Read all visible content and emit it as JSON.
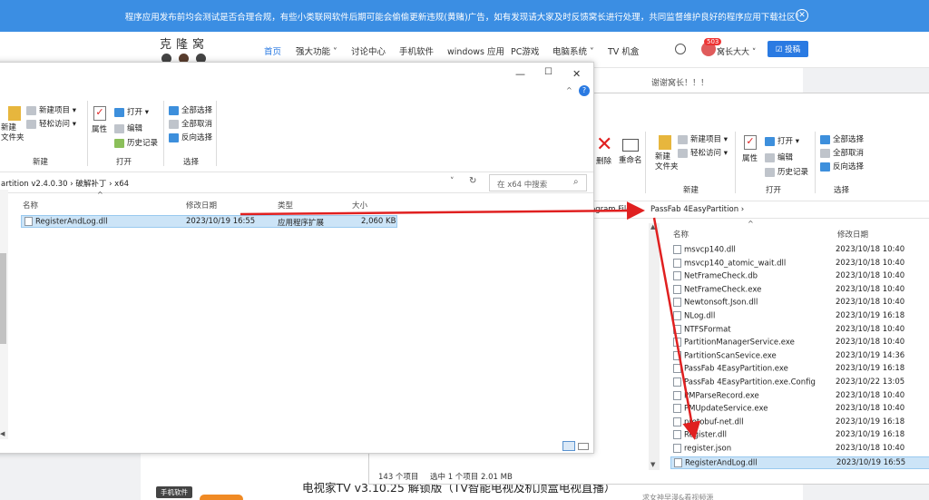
{
  "banner": {
    "text": "程序应用发布前均会测试是否合理合规，有些小类联网软件后期可能会偷偷更新违规(黄赌)广告，如有发现请大家及时反馈窝长进行处理，共同监督维护良好的程序应用下载社区！",
    "close": "✕"
  },
  "site": {
    "logo": "克隆窝",
    "nav": [
      "首页",
      "强大功能 ˅",
      "讨论中心",
      "手机软件",
      "windows 应用",
      "PC游戏",
      "电脑系统 ˅",
      "TV 机盒"
    ],
    "badge": "503",
    "user": "窝长大大 ˅",
    "post": "☑ 投稿",
    "thanks": "谢谢窝长！！！",
    "bottom_title": "电视家TV v3.10.25 解锁版（TV智能电视及机顶盒电视直播）",
    "tag_phone": "手机软件",
    "bottom_right": "求女神早漫&看视频源"
  },
  "win1": {
    "ribbon": {
      "new_folder": "新建\n文件夹",
      "new_item": "新建项目 ▾",
      "easy_access": "轻松访问 ▾",
      "new_group": "新建",
      "properties": "属性",
      "open": "打开 ▾",
      "edit": "编辑",
      "history": "历史记录",
      "open_group": "打开",
      "select_all": "全部选择",
      "select_none": "全部取消",
      "invert": "反向选择",
      "select_group": "选择"
    },
    "address": "artition v2.4.0.30  ›  破解补丁  ›  x64",
    "search_placeholder": "在 x64 中搜索",
    "columns": {
      "name": "名称",
      "date": "修改日期",
      "type": "类型",
      "size": "大小"
    },
    "files": [
      {
        "name": "RegisterAndLog.dll",
        "date": "2023/10/19 16:55",
        "type": "应用程序扩展",
        "size": "2,060 KB"
      }
    ]
  },
  "win2": {
    "ribbon": {
      "delete": "删除",
      "rename": "重命名",
      "new_folder": "新建\n文件夹",
      "new_item": "新建项目 ▾",
      "easy_access": "轻松访问 ▾",
      "new_group": "新建",
      "properties": "属性",
      "open": "打开 ▾",
      "edit": "编辑",
      "history": "历史记录",
      "open_group": "打开",
      "select_all": "全部选择",
      "select_none": "全部取消",
      "invert": "反向选择",
      "select_group": "选择"
    },
    "address_left": "ogram Files",
    "address": "PassFab 4EasyPartition  ›",
    "columns": {
      "name": "名称",
      "date": "修改日期"
    },
    "files": [
      {
        "name": "msvcp140.dll",
        "date": "2023/10/18 10:40"
      },
      {
        "name": "msvcp140_atomic_wait.dll",
        "date": "2023/10/18 10:40"
      },
      {
        "name": "NetFrameCheck.db",
        "date": "2023/10/18 10:40"
      },
      {
        "name": "NetFrameCheck.exe",
        "date": "2023/10/18 10:40"
      },
      {
        "name": "Newtonsoft.Json.dll",
        "date": "2023/10/18 10:40"
      },
      {
        "name": "NLog.dll",
        "date": "2023/10/19 16:18"
      },
      {
        "name": "NTFSFormat",
        "date": "2023/10/18 10:40"
      },
      {
        "name": "PartitionManagerService.exe",
        "date": "2023/10/18 10:40"
      },
      {
        "name": "PartitionScanSevice.exe",
        "date": "2023/10/19 14:36"
      },
      {
        "name": "PassFab 4EasyPartition.exe",
        "date": "2023/10/19 16:18"
      },
      {
        "name": "PassFab 4EasyPartition.exe.Config",
        "date": "2023/10/22 13:05"
      },
      {
        "name": "PMParseRecord.exe",
        "date": "2023/10/18 10:40"
      },
      {
        "name": "PMUpdateService.exe",
        "date": "2023/10/18 10:40"
      },
      {
        "name": "protobuf-net.dll",
        "date": "2023/10/19 16:18"
      },
      {
        "name": "Register.dll",
        "date": "2023/10/19 16:18"
      },
      {
        "name": "register.json",
        "date": "2023/10/18 10:40"
      },
      {
        "name": "RegisterAndLog.dll",
        "date": "2023/10/19 16:55"
      }
    ],
    "status_count": "143 个项目",
    "status_sel": "选中 1 个项目  2.01 MB"
  },
  "colors": {
    "banner": "#3b8ee3",
    "accent": "#2a7ae2",
    "selection": "#cce4f7",
    "arrow": "#e02020"
  }
}
